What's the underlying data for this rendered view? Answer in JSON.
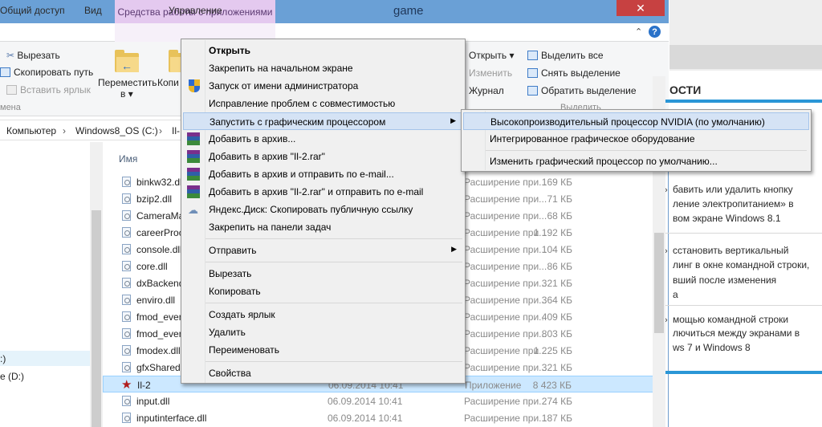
{
  "window": {
    "title": "game",
    "tools_tab": "Средства работы с приложениями",
    "close_glyph": "✕",
    "minimize_glyph": "⌃",
    "help_glyph": "?"
  },
  "ribbon_tabs": {
    "share": "Общий доступ",
    "view": "Вид",
    "manage": "Управление"
  },
  "ribbon": {
    "cut": "Вырезать",
    "copy_path": "Скопировать путь",
    "paste_shortcut": "Вставить ярлык",
    "clipboard_group": "мена",
    "move_to_line1": "Переместить",
    "move_to_line2": "в ▾",
    "copy_to_partial": "Копи",
    "open": "Открыть ▾",
    "edit": "Изменить",
    "history": "Журнал",
    "select_all": "Выделить все",
    "select_none": "Снять выделение",
    "invert_selection": "Обратить выделение",
    "select_group": "Выделить"
  },
  "address": {
    "crumb1": "Компьютер",
    "crumb2": "Windows8_OS (C:)",
    "crumb3": "Il-"
  },
  "nav": {
    "item_c": ":)",
    "item_d": "e (D:)"
  },
  "list": {
    "col_name": "Имя",
    "files": [
      {
        "name": "binkw32.dll",
        "date": "",
        "type": "Расширение при...",
        "size": "169 КБ"
      },
      {
        "name": "bzip2.dll",
        "date": "",
        "type": "Расширение при...",
        "size": "71 КБ"
      },
      {
        "name": "CameraMan",
        "date": "",
        "type": "Расширение при...",
        "size": "68 КБ"
      },
      {
        "name": "careerProc",
        "date": "",
        "type": "Расширение при...",
        "size": "1 192 КБ"
      },
      {
        "name": "console.dll",
        "date": "",
        "type": "Расширение при...",
        "size": "104 КБ"
      },
      {
        "name": "core.dll",
        "date": "",
        "type": "Расширение при...",
        "size": "86 КБ"
      },
      {
        "name": "dxBackend",
        "date": "",
        "type": "Расширение при...",
        "size": "321 КБ"
      },
      {
        "name": "enviro.dll",
        "date": "",
        "type": "Расширение при...",
        "size": "364 КБ"
      },
      {
        "name": "fmod_even",
        "date": "",
        "type": "Расширение при...",
        "size": "409 КБ"
      },
      {
        "name": "fmod_even",
        "date": "",
        "type": "Расширение при...",
        "size": "803 КБ"
      },
      {
        "name": "fmodex.dll",
        "date": "",
        "type": "Расширение при...",
        "size": "1 225 КБ"
      },
      {
        "name": "gfxShared.",
        "date": "",
        "type": "Расширение при...",
        "size": "321 КБ"
      },
      {
        "name": "Il-2",
        "date": "06.09.2014 10:41",
        "type": "Приложение",
        "size": "8 423 КБ"
      },
      {
        "name": "input.dll",
        "date": "06.09.2014 10:41",
        "type": "Расширение при...",
        "size": "274 КБ"
      },
      {
        "name": "inputinterface.dll",
        "date": "06.09.2014 10:41",
        "type": "Расширение при...",
        "size": "187 КБ"
      }
    ]
  },
  "context_menu": {
    "open": "Открыть",
    "pin_start": "Закрепить на начальном экране",
    "run_as_admin": "Запуск от имени администратора",
    "compat": "Исправление проблем с совместимостью",
    "run_gpu": "Запустить с графическим процессором",
    "add_archive": "Добавить в архив...",
    "add_rar": "Добавить в архив \"Il-2.rar\"",
    "add_email": "Добавить в архив и отправить по e-mail...",
    "add_rar_email": "Добавить в архив \"Il-2.rar\" и отправить по e-mail",
    "yadisk": "Яндекс.Диск: Скопировать публичную ссылку",
    "pin_taskbar": "Закрепить на панели задач",
    "send_to": "Отправить",
    "cut": "Вырезать",
    "copy": "Копировать",
    "create_shortcut": "Создать ярлык",
    "delete": "Удалить",
    "rename": "Переименовать",
    "properties": "Свойства",
    "arrow": "▶"
  },
  "gpu_submenu": {
    "nvidia": "Высокопроизводительный процессор NVIDIA (по умолчанию)",
    "integrated": "Интегрированное графическое оборудование",
    "change_default": "Изменить графический процессор по умолчанию..."
  },
  "browser_page": {
    "heading": "ОСТИ",
    "item1_l1": "бавить или удалить кнопку",
    "item1_l2": "ление электропитанием» в",
    "item1_l3": "вом экране Windows 8.1",
    "item2_l1": "сстановить вертикальный",
    "item2_l2": "линг в окне командной строки,",
    "item2_l3": "вший после изменения",
    "item2_l4": "а",
    "item3_l1": "мощью командной строки",
    "item3_l2": "лючиться между экранами в",
    "item3_l3": "ws 7 и Windows 8",
    "bullet": "›"
  }
}
